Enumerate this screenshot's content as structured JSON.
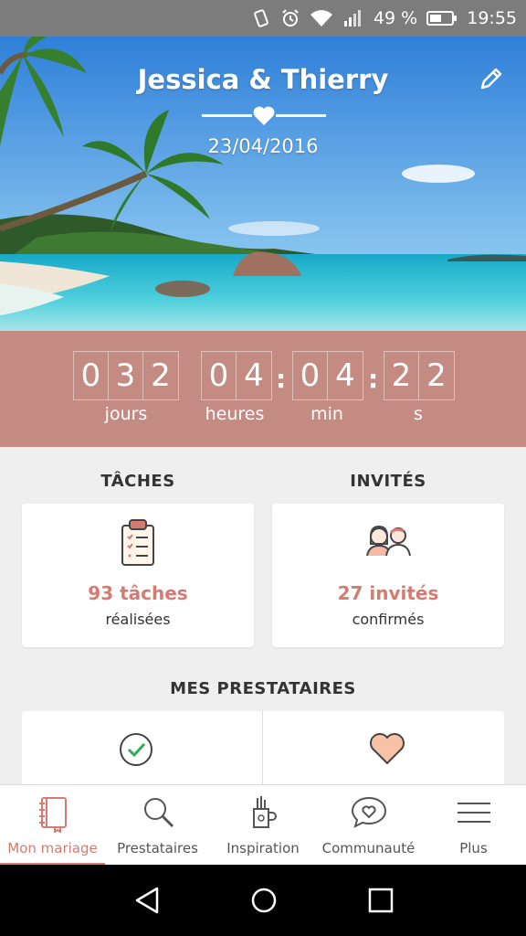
{
  "status_bar": {
    "battery": "49 %",
    "time": "19:55",
    "icons": [
      "vibrate-icon",
      "alarm-icon",
      "wifi-icon",
      "signal-icon",
      "battery-icon"
    ]
  },
  "hero": {
    "couple": "Jessica & Thierry",
    "date": "23/04/2016",
    "edit_icon": "pencil-icon"
  },
  "countdown": {
    "days": [
      "0",
      "3",
      "2"
    ],
    "hours": [
      "0",
      "4"
    ],
    "minutes": [
      "0",
      "4"
    ],
    "seconds": [
      "2",
      "2"
    ],
    "labels": {
      "days": "jours",
      "hours": "heures",
      "minutes": "min",
      "seconds": "s"
    }
  },
  "tasks": {
    "title": "TÂCHES",
    "count": "93 tâches",
    "sub": "réalisées",
    "icon": "clipboard-icon"
  },
  "guests": {
    "title": "INVITÉS",
    "count": "27 invités",
    "sub": "confirmés",
    "icon": "couple-icon"
  },
  "vendors": {
    "title": "MES PRESTATAIRES",
    "icons": [
      "check-circle-icon",
      "heart-icon"
    ]
  },
  "bottom_nav": [
    {
      "label": "Mon mariage",
      "icon": "notebook-icon",
      "active": true
    },
    {
      "label": "Prestataires",
      "icon": "search-icon",
      "active": false
    },
    {
      "label": "Inspiration",
      "icon": "pencil-cup-icon",
      "active": false
    },
    {
      "label": "Communauté",
      "icon": "chat-heart-icon",
      "active": false
    },
    {
      "label": "Plus",
      "icon": "menu-icon",
      "active": false
    }
  ],
  "colors": {
    "accent": "#d67b72",
    "countdown_bg": "#c48b82"
  }
}
